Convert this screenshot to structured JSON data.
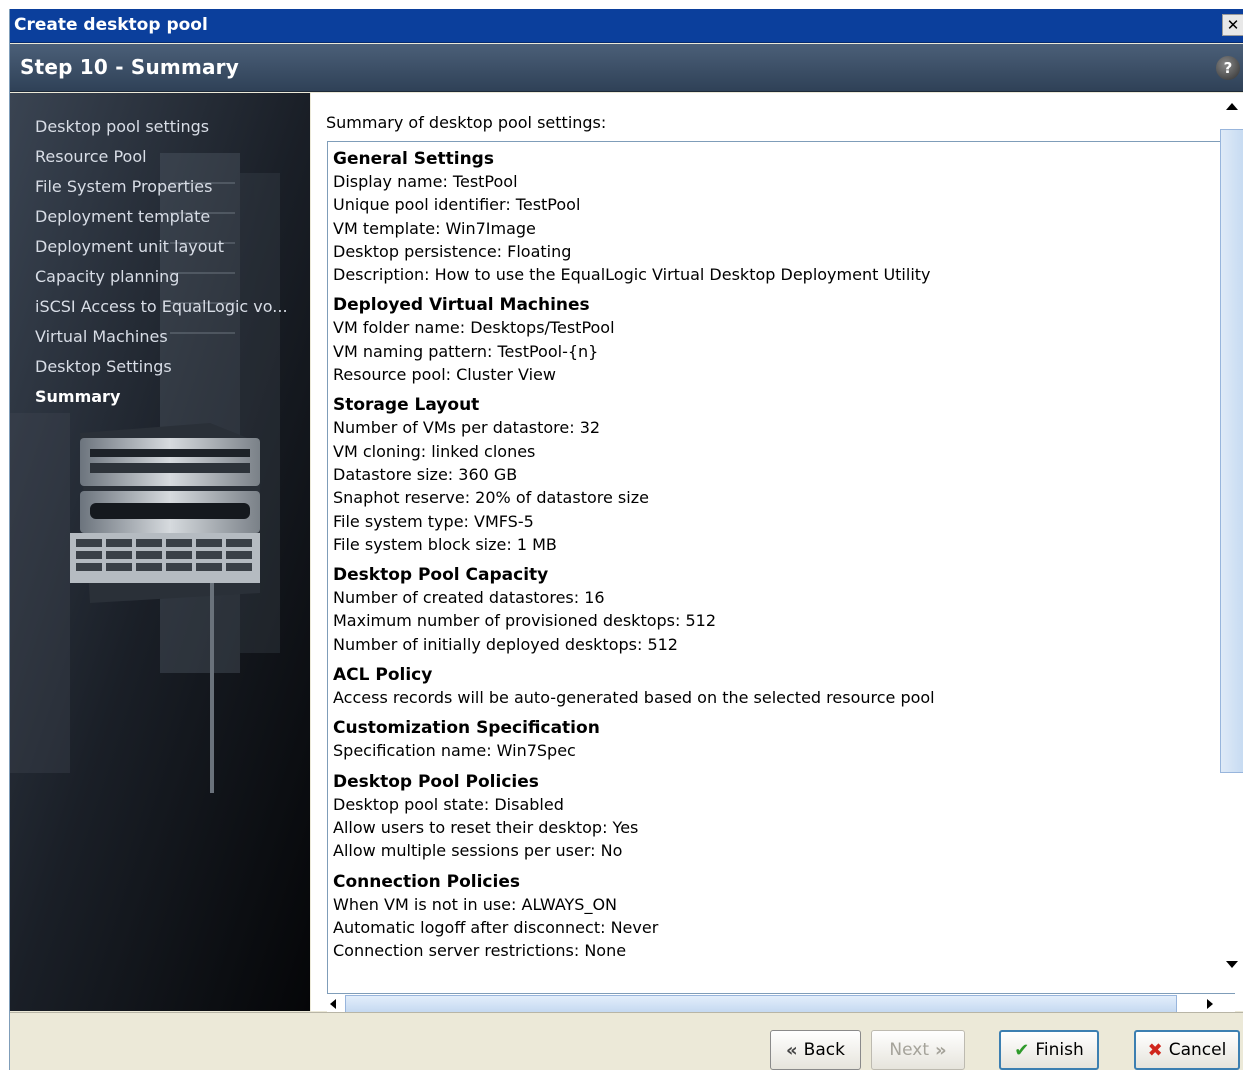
{
  "window": {
    "title": "Create desktop pool",
    "close_symbol": "✕"
  },
  "header": {
    "step_title": "Step 10 - Summary",
    "help_symbol": "?"
  },
  "sidebar": {
    "items": [
      {
        "label": "Desktop pool settings"
      },
      {
        "label": "Resource Pool"
      },
      {
        "label": "File System Properties"
      },
      {
        "label": "Deployment template"
      },
      {
        "label": "Deployment unit layout"
      },
      {
        "label": "Capacity planning"
      },
      {
        "label": "iSCSI Access to EqualLogic vo..."
      },
      {
        "label": "Virtual Machines"
      },
      {
        "label": "Desktop Settings"
      },
      {
        "label": "Summary",
        "active": true
      }
    ]
  },
  "summary": {
    "intro": "Summary of desktop pool settings:",
    "sections": [
      {
        "heading": "General Settings",
        "lines": [
          "Display name:  TestPool",
          "Unique pool identifier:  TestPool",
          "VM template:  Win7Image",
          "Desktop persistence:  Floating",
          "Description:  How to use the EqualLogic Virtual Desktop Deployment Utility"
        ]
      },
      {
        "heading": "Deployed Virtual Machines",
        "lines": [
          "VM folder name:  Desktops/TestPool",
          "VM naming pattern:  TestPool-{n}",
          "Resource pool:  Cluster View"
        ]
      },
      {
        "heading": "Storage Layout",
        "lines": [
          "Number of VMs per datastore:  32",
          "VM cloning:  linked clones",
          "Datastore size:  360 GB",
          "Snaphot reserve:  20% of datastore size",
          "File system type:  VMFS-5",
          "File system block size:  1 MB"
        ]
      },
      {
        "heading": "Desktop Pool Capacity",
        "lines": [
          "Number of created datastores:  16",
          "Maximum number of provisioned desktops:  512",
          "Number of initially deployed desktops:  512"
        ]
      },
      {
        "heading": "ACL Policy",
        "lines": [
          "Access records will be auto-generated based on the selected resource pool"
        ]
      },
      {
        "heading": "Customization Specification",
        "lines": [
          "Specification name:  Win7Spec"
        ]
      },
      {
        "heading": "Desktop Pool Policies",
        "lines": [
          "Desktop pool state:  Disabled",
          "Allow users to reset their desktop:  Yes",
          "Allow multiple sessions per user:  No"
        ]
      },
      {
        "heading": "Connection Policies",
        "lines": [
          "When VM is not in use:  ALWAYS_ON",
          "Automatic logoff after disconnect:  Never",
          "Connection server restrictions:  None"
        ]
      }
    ]
  },
  "footer": {
    "back": {
      "icon": "«",
      "label": "Back",
      "icon_name": "double-chevron-left-icon"
    },
    "next": {
      "icon": "»",
      "label": "Next",
      "icon_name": "double-chevron-right-icon",
      "disabled": true
    },
    "finish": {
      "icon": "✔",
      "label": "Finish",
      "icon_name": "green-check-icon"
    },
    "cancel": {
      "icon": "✖",
      "label": "Cancel",
      "icon_name": "red-x-icon"
    }
  },
  "colors": {
    "titlebar": "#0b3f9c",
    "stepbar": "#3b4d63",
    "sidebar_bg": "#0a0c10",
    "dialog_bg": "#ece9d8"
  }
}
